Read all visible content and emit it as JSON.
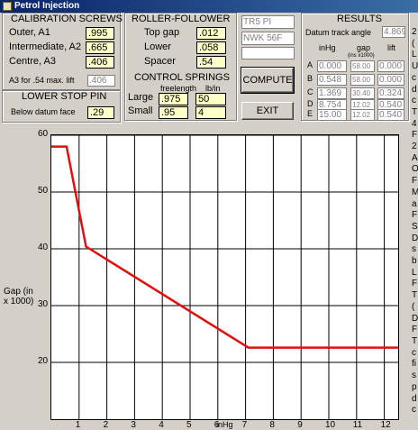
{
  "window": {
    "title": "Petrol Injection"
  },
  "calibration": {
    "heading": "CALIBRATION SCREWS",
    "rows": [
      {
        "label": "Outer, A1",
        "value": ".995"
      },
      {
        "label": "Intermediate, A2",
        "value": ".665"
      },
      {
        "label": "Centre, A3",
        "value": ".406"
      }
    ],
    "a3_label": "A3 for .54 max. lift",
    "a3_value": ".406"
  },
  "lower_stop": {
    "heading": "LOWER STOP PIN",
    "label": "Below datum face",
    "value": ".29"
  },
  "roller": {
    "heading": "ROLLER-FOLLOWER",
    "rows": [
      {
        "label": "Top gap",
        "value": ".012"
      },
      {
        "label": "Lower",
        "value": ".058"
      },
      {
        "label": "Spacer",
        "value": ".54"
      }
    ]
  },
  "springs": {
    "heading": "CONTROL SPRINGS",
    "col1": "freelength",
    "col2": "lb/in",
    "rows": [
      {
        "label": "Large",
        "freelength": ".975",
        "rate": "50"
      },
      {
        "label": "Small",
        "freelength": ".95",
        "rate": "4"
      }
    ]
  },
  "info": {
    "field1": "TR5 PI",
    "field2": "NWK 56F",
    "field3": ""
  },
  "buttons": {
    "compute": "COMPUTE",
    "exit": "EXIT"
  },
  "results": {
    "heading": "RESULTS",
    "datum_label": "Datum track angle",
    "datum_value": "4.869",
    "col_inhg": "inHg",
    "col_gap": "gap",
    "col_gap_sub": "(ins x1000)",
    "col_lift": "lift",
    "rows": [
      {
        "id": "A",
        "inhg": "0.000",
        "gap": "58.00",
        "lift": "0.000"
      },
      {
        "id": "B",
        "inhg": "0.548",
        "gap": "58.00",
        "lift": "0.000"
      },
      {
        "id": "C",
        "inhg": "1.369",
        "gap": "30.40",
        "lift": "0.324"
      },
      {
        "id": "D",
        "inhg": "8.754",
        "gap": "12.02",
        "lift": "0.540"
      },
      {
        "id": "E",
        "inhg": "15.00",
        "gap": "12.02",
        "lift": "0.540"
      }
    ]
  },
  "right_edge_text": [
    "2",
    "(",
    "L",
    "U",
    "c",
    "d",
    "c",
    "T",
    "4",
    "F",
    "2",
    "A",
    "O",
    "F",
    "M",
    "a",
    "F",
    "S",
    "D",
    "s",
    "b",
    "L",
    "F",
    "T",
    "(",
    "D",
    "F",
    "T",
    "c",
    "fi",
    "s",
    "p",
    "d",
    "c"
  ],
  "chart_data": {
    "type": "line",
    "title": "",
    "xlabel": "inHg",
    "ylabel": "Gap (in x 1000)",
    "ylim": [
      10,
      60
    ],
    "xlim": [
      0,
      12.5
    ],
    "yticks": [
      60,
      50,
      40,
      30,
      20
    ],
    "xticks": [
      1,
      2,
      3,
      4,
      5,
      6,
      7,
      8,
      9,
      10,
      11,
      12
    ],
    "grid": true,
    "color": "#e01010",
    "series": [
      {
        "x": [
          0,
          0.55,
          1.25,
          7.1,
          12.5
        ],
        "y": [
          58,
          58,
          40.4,
          22.6,
          22.6
        ]
      }
    ]
  }
}
